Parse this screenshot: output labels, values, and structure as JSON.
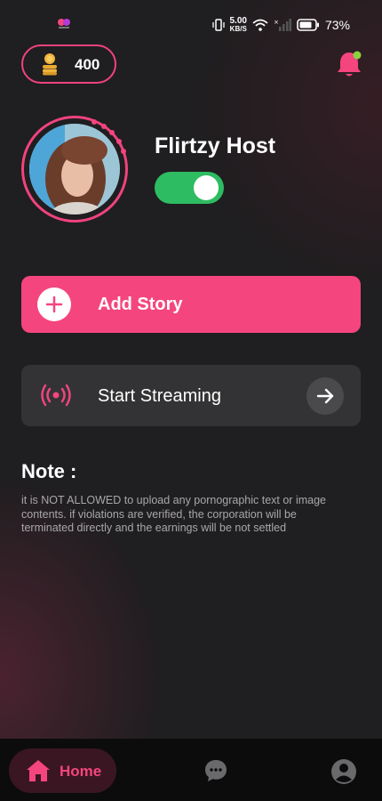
{
  "status_bar": {
    "speed_value": "5.00",
    "speed_unit": "KB/S",
    "battery_percent": "73%"
  },
  "header": {
    "coin_balance": "400"
  },
  "profile": {
    "name": "Flirtzy Host",
    "online_toggle_on": true
  },
  "actions": {
    "add_story_label": "Add Story",
    "start_streaming_label": "Start Streaming"
  },
  "note": {
    "title": "Note :",
    "text": "it is NOT ALLOWED to upload any pornographic text or image contents. if violations are verified, the corporation will be terminated directly and the earnings will be not settled"
  },
  "bottom_nav": {
    "home_label": "Home",
    "items": [
      "home-icon",
      "chat-icon",
      "profile-icon"
    ]
  },
  "colors": {
    "accent": "#f5457e",
    "toggle_on": "#2ebc62",
    "background": "#1f1e20"
  }
}
